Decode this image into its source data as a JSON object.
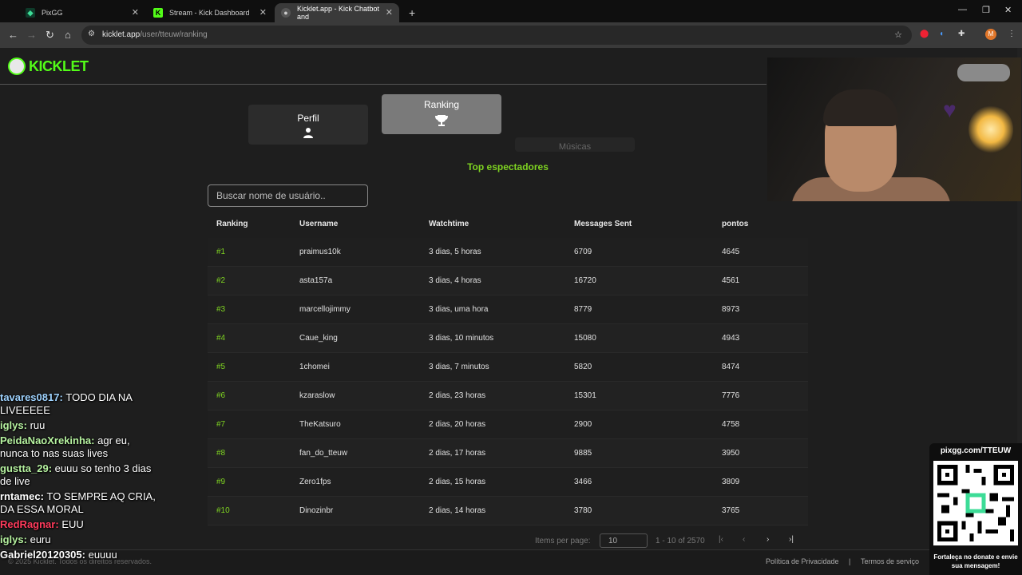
{
  "browser": {
    "tabs": [
      {
        "label": "PixGG",
        "icon": "pixgg-icon"
      },
      {
        "label": "Stream - Kick Dashboard",
        "icon": "kick-icon"
      },
      {
        "label": "Kicklet.app - Kick Chatbot and",
        "icon": "kicklet-icon"
      }
    ],
    "url_host": "kicklet.app",
    "url_path": "/user/tteuw/ranking",
    "profile_initial": "M"
  },
  "site": {
    "logo_text": "KICKLET",
    "nav": [
      {
        "label": "Perfil",
        "icon": "user-icon"
      },
      {
        "label": "Ranking",
        "icon": "trophy-icon"
      },
      {
        "label": "Músicas",
        "icon": "music-icon"
      }
    ],
    "subtitle": "Top espectadores",
    "search_placeholder": "Buscar nome de usuário..",
    "table": {
      "headers": [
        "Ranking",
        "Username",
        "Watchtime",
        "Messages Sent",
        "pontos"
      ],
      "rows": [
        [
          "#1",
          "praimus10k",
          "3 dias, 5 horas",
          "6709",
          "4645"
        ],
        [
          "#2",
          "asta157a",
          "3 dias, 4 horas",
          "16720",
          "4561"
        ],
        [
          "#3",
          "marcellojimmy",
          "3 dias, uma hora",
          "8779",
          "8973"
        ],
        [
          "#4",
          "Caue_king",
          "3 dias, 10 minutos",
          "15080",
          "4943"
        ],
        [
          "#5",
          "1chomei",
          "3 dias, 7 minutos",
          "5820",
          "8474"
        ],
        [
          "#6",
          "kzaraslow",
          "2 dias, 23 horas",
          "15301",
          "7776"
        ],
        [
          "#7",
          "TheKatsuro",
          "2 dias, 20 horas",
          "2900",
          "4758"
        ],
        [
          "#8",
          "fan_do_tteuw",
          "2 dias, 17 horas",
          "9885",
          "3950"
        ],
        [
          "#9",
          "Zero1fps",
          "2 dias, 15 horas",
          "3466",
          "3809"
        ],
        [
          "#10",
          "Dinozinbr",
          "2 dias, 14 horas",
          "3780",
          "3765"
        ]
      ]
    },
    "pager": {
      "items_label": "Items per page:",
      "per_page": "10",
      "range": "1 - 10 of 2570"
    },
    "footer": {
      "copyright": "© 2025 Kicklet. Todos os direitos reservados.",
      "privacy": "Política de Privacidade",
      "separator": "|",
      "terms": "Termos de serviço"
    }
  },
  "chat": [
    {
      "user": "tavares0817:",
      "text": "TODO DIA NA LIVEEEEE",
      "color": "#9fd3ff"
    },
    {
      "user": "iglys:",
      "text": "ruu",
      "color": "#b6f2a0"
    },
    {
      "user": "PeidaNaoXrekinha:",
      "text": "agr eu, nunca to nas suas lives",
      "color": "#b6f2a0"
    },
    {
      "user": "gustta_29:",
      "text": "euuu so tenho 3 dias de live",
      "color": "#b6f2a0"
    },
    {
      "user": "rntamec:",
      "text": "TO SEMPRE AQ CRIA, DA ESSA MORAL",
      "color": "#ffffff"
    },
    {
      "user": "RedRagnar:",
      "text": "EUU",
      "color": "#ff3b5c"
    },
    {
      "user": "iglys:",
      "text": "euru",
      "color": "#b6f2a0"
    },
    {
      "user": "Gabriel20120305:",
      "text": "euuuu",
      "color": "#ffffff"
    }
  ],
  "overlay": {
    "qr_url": "pixgg.com/TTEUW",
    "qr_message": "Fortaleça no donate e envie sua mensagem!"
  },
  "colors": {
    "accent": "#53fc18",
    "rank_green": "#7ed321",
    "active_tab": "#7a7a7a"
  }
}
